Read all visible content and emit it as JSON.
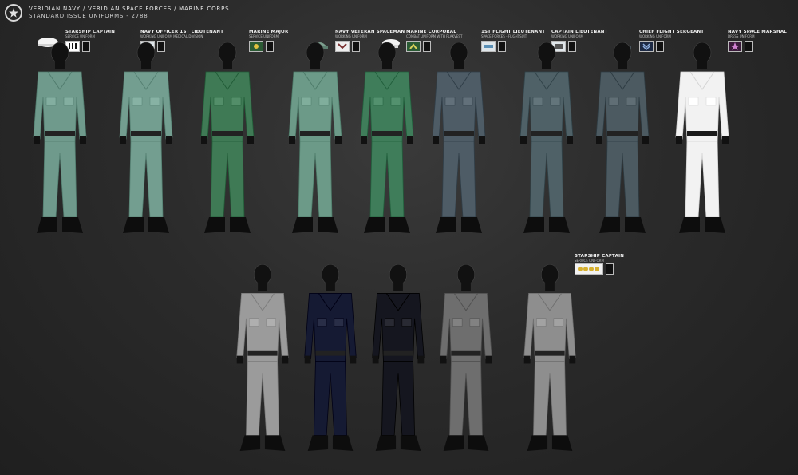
{
  "header": {
    "title": "Veridian Navy / Veridian Space Forces / Marine Corps",
    "subtitle": "Standard Issue Uniforms - 2788"
  },
  "top_row": [
    {
      "rank": "Starship Captain",
      "sub": "Service Uniform",
      "color": "#6f9a8c"
    },
    {
      "rank": "Navy Officer 1st Lieutenant",
      "sub": "Working Uniform Medical Division",
      "color": "#739e90"
    },
    {
      "rank": "Marine Major",
      "sub": "Service Uniform",
      "color": "#3f7a55"
    },
    {
      "rank": "Navy Veteran Spaceman",
      "sub": "Working Uniform",
      "color": "#6c9a88"
    },
    {
      "rank": "Marine Corporal",
      "sub": "Combat Uniform with Flakvest",
      "color": "#3f7d5a"
    },
    {
      "rank": "1st Flight Lieutenant",
      "sub": "Space Forces - Flightsuit",
      "color": "#4e5c66"
    },
    {
      "rank": "Captain Lieutenant",
      "sub": "Working Uniform",
      "color": "#4f6167"
    },
    {
      "rank": "Chief Flight Sergeant",
      "sub": "Working Uniform",
      "color": "#4c5a61"
    },
    {
      "rank": "Navy Space Marshal",
      "sub": "Dress Uniform",
      "color": "#f2f2f2"
    }
  ],
  "bottom_row": [
    {
      "color": "#9b9b9b"
    },
    {
      "color": "#151a33"
    },
    {
      "color": "#15161f"
    },
    {
      "color": "#6e6e6e"
    },
    {
      "color": "#8e8e8e"
    }
  ],
  "bottom_label": {
    "rank": "Starship Captain",
    "sub": "Service Uniform"
  },
  "icons": {
    "emblem": "star-emblem-icon"
  }
}
